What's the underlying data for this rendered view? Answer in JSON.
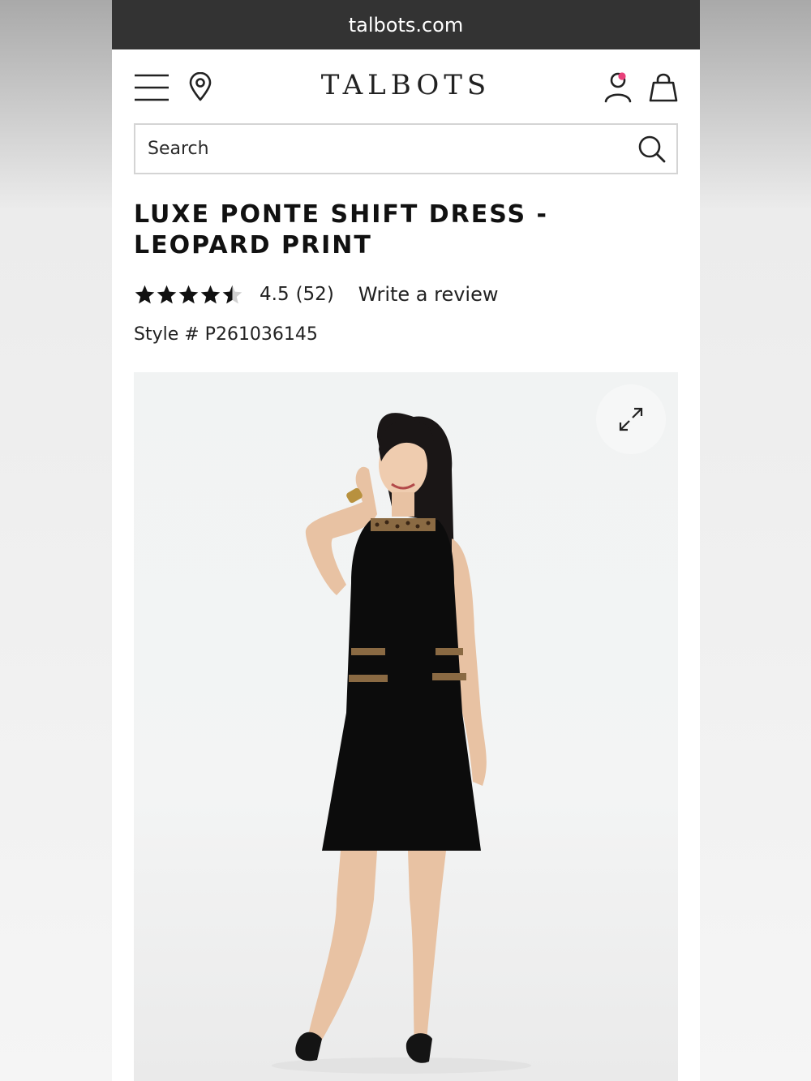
{
  "browser": {
    "url": "talbots.com"
  },
  "header": {
    "logo": "TALBOTS",
    "icons": [
      "menu-icon",
      "location-icon",
      "account-icon",
      "shopping-bag-icon"
    ],
    "account_badge_color": "#e8407a"
  },
  "search": {
    "placeholder": "Search",
    "value": ""
  },
  "product": {
    "title": "LUXE PONTE SHIFT DRESS - LEOPARD PRINT",
    "rating_value": 4.5,
    "rating": "4.5",
    "review_count": "(52)",
    "write_review_label": "Write a review",
    "style_number": "Style # P261036145",
    "image": {
      "subject": "model",
      "expand_icon": "expand-icon"
    }
  }
}
